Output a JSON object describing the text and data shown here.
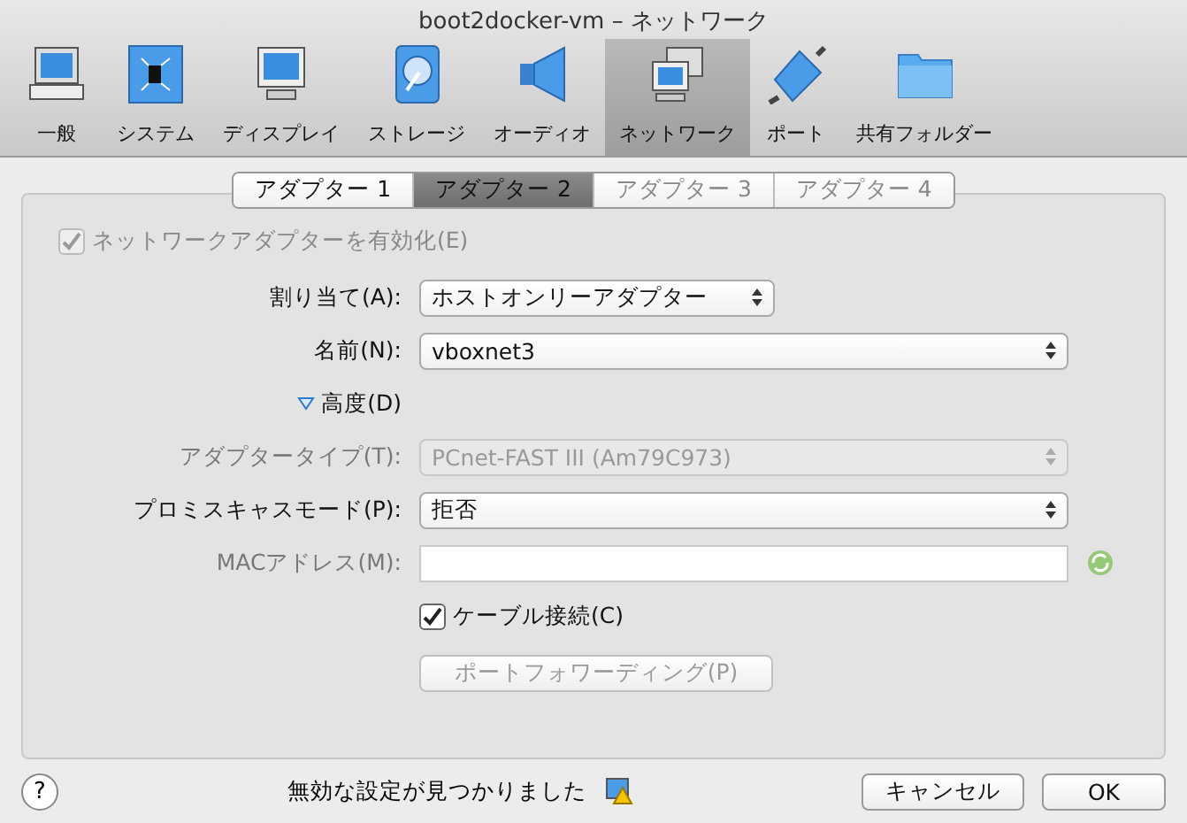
{
  "window": {
    "title": "boot2docker-vm – ネットワーク"
  },
  "toolbar": [
    {
      "label": "一般",
      "kind": "computer",
      "selected": false
    },
    {
      "label": "システム",
      "kind": "chip",
      "selected": false
    },
    {
      "label": "ディスプレイ",
      "kind": "monitor",
      "selected": false
    },
    {
      "label": "ストレージ",
      "kind": "disk",
      "selected": false
    },
    {
      "label": "オーディオ",
      "kind": "speaker",
      "selected": false
    },
    {
      "label": "ネットワーク",
      "kind": "network",
      "selected": true
    },
    {
      "label": "ポート",
      "kind": "plug",
      "selected": false
    },
    {
      "label": "共有フォルダー",
      "kind": "folder",
      "selected": false
    }
  ],
  "tabs": [
    {
      "label": "アダプター 1",
      "selected": false,
      "disabled": false
    },
    {
      "label": "アダプター 2",
      "selected": true,
      "disabled": false
    },
    {
      "label": "アダプター 3",
      "selected": false,
      "disabled": true
    },
    {
      "label": "アダプター 4",
      "selected": false,
      "disabled": true
    }
  ],
  "enable_adapter": {
    "label": "ネットワークアダプターを有効化(E)",
    "checked": true,
    "disabled": true
  },
  "fields": [
    {
      "kind": "select",
      "label": "割り当て(A):",
      "value": "ホストオンリーアダプター",
      "disabled": false,
      "wide": false
    },
    {
      "kind": "select",
      "label": "名前(N):",
      "value": "vboxnet3",
      "disabled": false,
      "wide": true
    },
    {
      "kind": "toggle",
      "label": "高度(D)",
      "expanded": true
    },
    {
      "kind": "select",
      "label": "アダプタータイプ(T):",
      "value": "PCnet-FAST III (Am79C973)",
      "disabled": true,
      "wide": true
    },
    {
      "kind": "select",
      "label": "プロミスキャスモード(P):",
      "value": "拒否",
      "disabled": false,
      "wide": true
    },
    {
      "kind": "text",
      "label": "MACアドレス(M):",
      "disabled": true
    },
    {
      "kind": "checkbox",
      "label": "ケーブル接続(C)",
      "checked": true
    },
    {
      "kind": "button",
      "label": "ポートフォワーディング(P)",
      "disabled": true
    }
  ],
  "status": {
    "help": "?",
    "message": "無効な設定が見つかりました"
  },
  "buttons": [
    {
      "label": "キャンセル"
    },
    {
      "label": "OK"
    }
  ]
}
